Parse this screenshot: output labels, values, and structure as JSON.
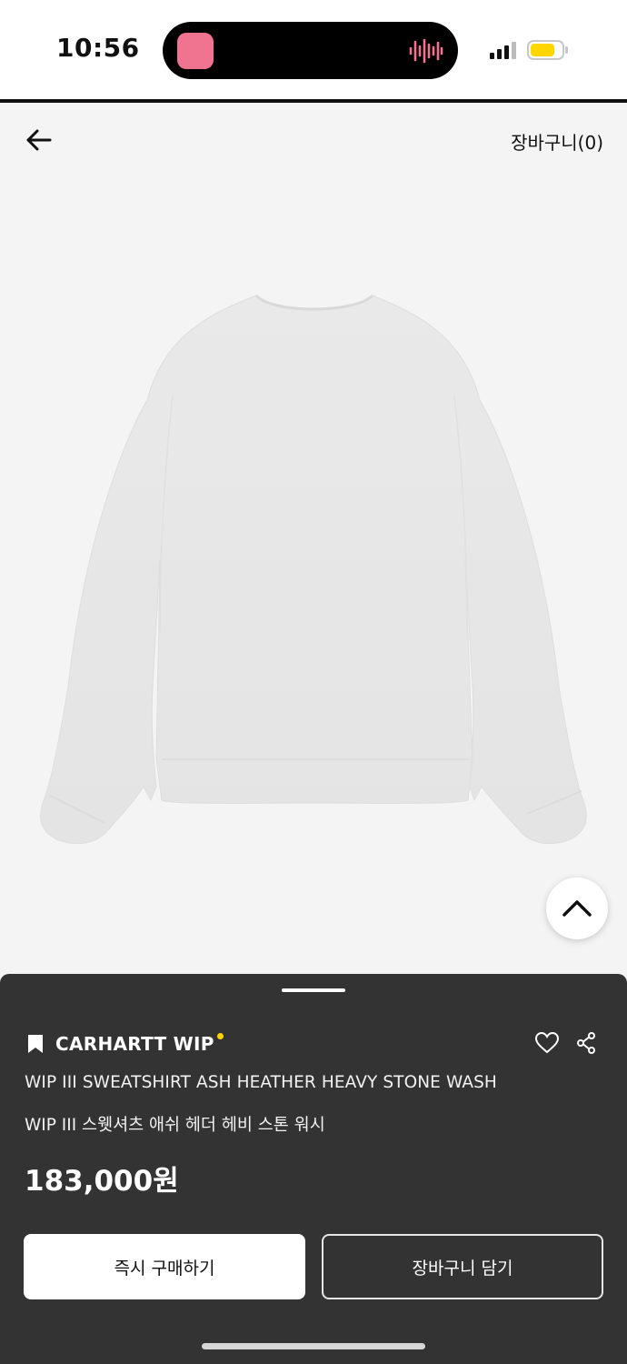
{
  "status_bar": {
    "time": "10:56",
    "icons": [
      "app-icon",
      "audio-wave-icon",
      "signal-icon",
      "battery-icon"
    ],
    "colors": {
      "app": "#f0738f",
      "wave": "#f0738f",
      "battery": "#ffd600"
    }
  },
  "nav": {
    "back_icon": "arrow-left-icon",
    "cart_label": "장바구니(0)"
  },
  "product": {
    "image_subject": "sweatshirt-image",
    "scroll_top_icon": "chevron-up-icon",
    "brand": "CARHARTT WIP",
    "title_en": "WIP III SWEATSHIRT ASH HEATHER HEAVY STONE WASH",
    "title_ko": "WIP III 스웻셔츠 애쉬 헤더 헤비 스톤 워시",
    "price": "183,000원",
    "icons": [
      "bookmark-icon",
      "heart-icon",
      "share-icon"
    ],
    "brand_dot_color": "#ffd600"
  },
  "actions": {
    "buy_now": "즉시 구매하기",
    "add_to_cart": "장바구니 담기"
  },
  "colors": {
    "sheet_bg": "#333333",
    "page_bg": "#f4f4f4"
  }
}
